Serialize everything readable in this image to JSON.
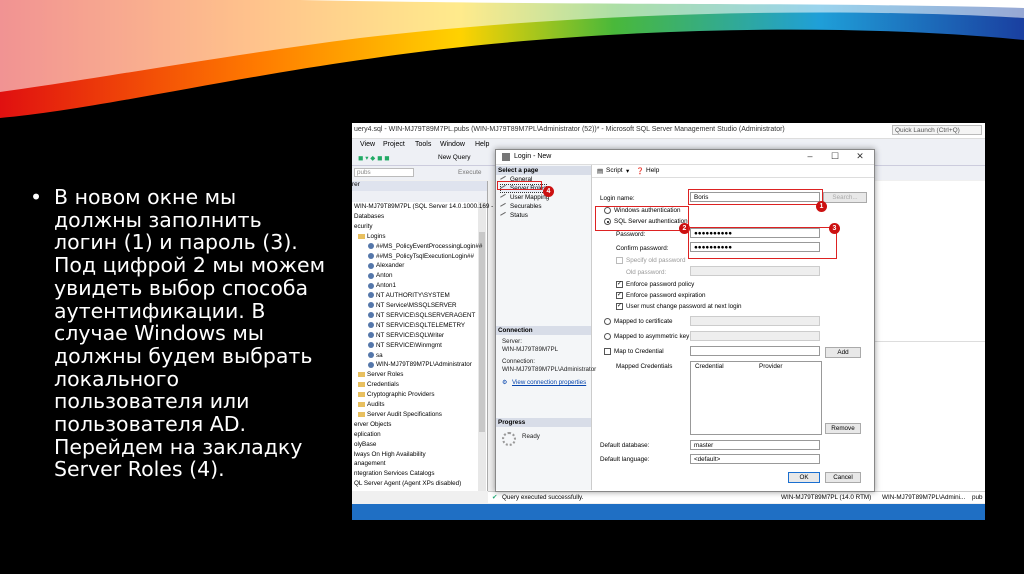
{
  "slide": {
    "bullet": "•",
    "text": "В новом окне мы должны заполнить логин (1) и пароль (3). Под цифрой 2 мы можем увидеть выбор способа аутентификации. В случае Windows мы должны будем выбрать локального пользователя или пользователя AD. Перейдем на закладку Server Roles (4)."
  },
  "ssms": {
    "window_title": "uery4.sql - WIN-MJ79T89M7PL.pubs (WIN-MJ79T89M7PL\\Administrator (52))* - Microsoft SQL Server Management Studio (Administrator)",
    "quick_launch": "Quick Launch (Ctrl+Q)",
    "menu": [
      "View",
      "Project",
      "Tools",
      "Window",
      "Help"
    ],
    "new_query": "New Query",
    "db_combo": "pubs",
    "execute": "Execute",
    "object_explorer_header": "rer",
    "tree": [
      "WIN-MJ79T89M7PL (SQL Server 14.0.1000.169 - W",
      "Databases",
      "ecurity",
      "Logins",
      "##MS_PolicyEventProcessingLogin##",
      "##MS_PolicyTsqlExecutionLogin##",
      "Alexander",
      "Anton",
      "Anton1",
      "NT AUTHORITY\\SYSTEM",
      "NT Service\\MSSQLSERVER",
      "NT SERVICE\\SQLSERVERAGENT",
      "NT SERVICE\\SQLTELEMETRY",
      "NT SERVICE\\SQLWriter",
      "NT SERVICE\\Winmgmt",
      "sa",
      "WIN-MJ79T89M7PL\\Administrator",
      "Server Roles",
      "Credentials",
      "Cryptographic Providers",
      "Audits",
      "Server Audit Specifications",
      "erver Objects",
      "eplication",
      "olyBase",
      "lways On High Availability",
      "anagement",
      "ntegration Services Catalogs",
      "QL Server Agent (Agent XPs disabled)"
    ],
    "status": {
      "message": "Query executed successfully.",
      "server": "WIN-MJ79T89M7PL (14.0 RTM)",
      "user": "WIN-MJ79T89M7PL\\Admini...",
      "db": "pub"
    }
  },
  "dialog": {
    "title": "Login - New",
    "select_page_header": "Select a page",
    "pages": [
      "General",
      "Server Roles",
      "User Mapping",
      "Securables",
      "Status"
    ],
    "connection_header": "Connection",
    "server_label": "Server:",
    "server_value": "WIN-MJ79T89M7PL",
    "connection_label": "Connection:",
    "connection_value": "WIN-MJ79T89M7PL\\Administrator",
    "view_connection_properties": "View connection properties",
    "progress_header": "Progress",
    "progress_status": "Ready",
    "toolbar": {
      "script": "Script",
      "help": "Help"
    },
    "login_name_label": "Login name:",
    "login_name_value": "Boris",
    "search_button": "Search...",
    "windows_auth": "Windows authentication",
    "sql_auth": "SQL Server authentication",
    "password_label": "Password:",
    "password_value": "●●●●●●●●●●",
    "confirm_password_label": "Confirm password:",
    "confirm_password_value": "●●●●●●●●●●",
    "specify_old_password": "Specify old password",
    "old_password_label": "Old password:",
    "enforce_policy": "Enforce password policy",
    "enforce_expiration": "Enforce password expiration",
    "must_change": "User must change password at next login",
    "mapped_to_certificate": "Mapped to certificate",
    "mapped_to_asym_key": "Mapped to asymmetric key",
    "map_to_credential": "Map to Credential",
    "add_button": "Add",
    "mapped_credentials_label": "Mapped Credentials",
    "grid_headers": [
      "Credential",
      "Provider"
    ],
    "remove_button": "Remove",
    "default_database_label": "Default database:",
    "default_database_value": "master",
    "default_language_label": "Default language:",
    "default_language_value": "<default>",
    "ok_button": "OK",
    "cancel_button": "Cancel",
    "checkmark": "✓"
  },
  "annotations": [
    "1",
    "2",
    "3",
    "4"
  ]
}
